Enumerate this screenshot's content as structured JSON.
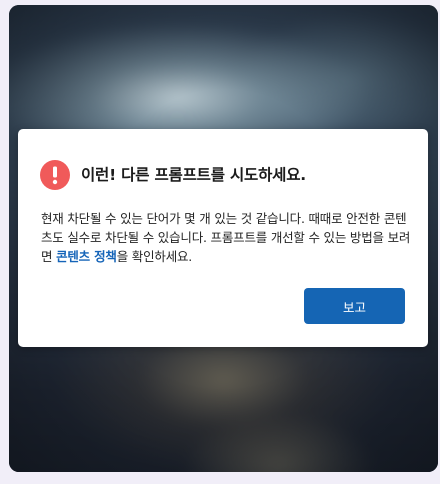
{
  "dialog": {
    "title": "이런! 다른 프롬프트를 시도하세요.",
    "body_before_link": "현재 차단될 수 있는 단어가 몇 개 있는 것 같습니다. 때때로 안전한 콘텐츠도 실수로 차단될 수 있습니다. 프롬프트를 개선할 수 있는 방법을 보려면 ",
    "link_text": "콘텐츠 정책",
    "body_after_link": "을 확인하세요.",
    "ok_button_label": "보고",
    "icon": "alert-icon"
  },
  "colors": {
    "alert_icon": "#f05a5a",
    "link": "#1564b8",
    "primary_button": "#1565b4"
  }
}
